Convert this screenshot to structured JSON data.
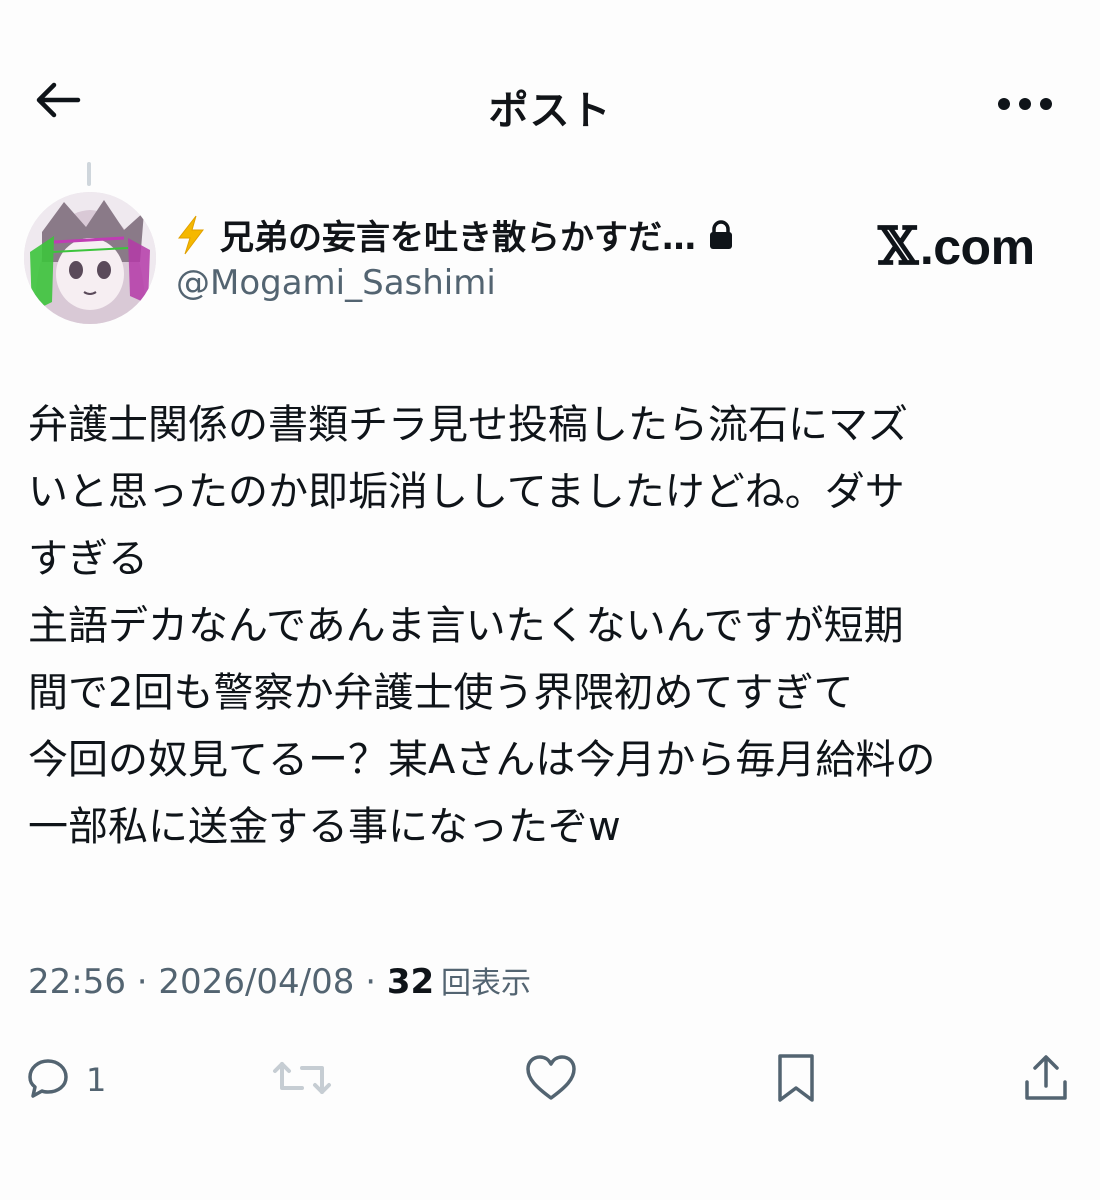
{
  "header": {
    "title": "ポスト"
  },
  "author": {
    "display_name": "兄弟の妄言を吐き散らかすだ…",
    "username": "@Mogami_Sashimi"
  },
  "watermark": {
    "x_mark": "𝕏",
    "domain": ".com"
  },
  "post": {
    "lines": [
      "弁護士関係の書類チラ見せ投稿したら流石にマズ",
      "いと思ったのか即垢消ししてましたけどね。ダサ",
      "すぎる",
      "主語デカなんであんま言いたくないんですが短期",
      "間で2回も警察か弁護士使う界隈初めてすぎて",
      "今回の奴見てるー？某Aさんは今月から毎月給料の",
      "一部私に送金する事になったぞw"
    ]
  },
  "meta": {
    "time": "22:56",
    "separator1": " · ",
    "date": "2026/04/08",
    "separator2": " · ",
    "views_count": "32",
    "views_label": "回表示"
  },
  "actions": {
    "reply_count": "1"
  },
  "icons": {
    "back": "arrow-left-icon",
    "more": "more-horizontal-icon",
    "bolt": "lightning-bolt-icon",
    "lock": "lock-icon",
    "reply": "speech-bubble-icon",
    "repost": "repost-arrows-icon",
    "like": "heart-icon",
    "bookmark": "bookmark-icon",
    "share": "share-upload-icon"
  },
  "colors": {
    "text": "#0f1419",
    "secondary": "#536471",
    "bolt": "#f5b800",
    "repost_disabled": "#c6cdd3"
  }
}
